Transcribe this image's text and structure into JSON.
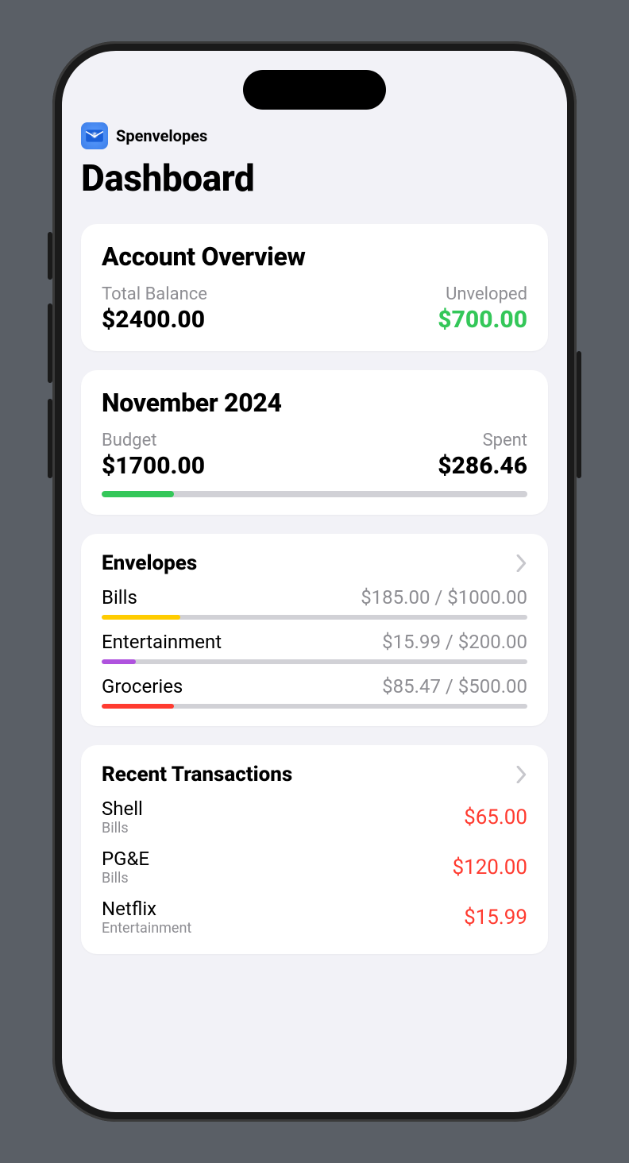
{
  "app": {
    "name": "Spenvelopes"
  },
  "page": {
    "title": "Dashboard"
  },
  "overview": {
    "title": "Account Overview",
    "total_label": "Total Balance",
    "total_value": "$2400.00",
    "unveloped_label": "Unveloped",
    "unveloped_value": "$700.00"
  },
  "month": {
    "title": "November 2024",
    "budget_label": "Budget",
    "budget_value": "$1700.00",
    "spent_label": "Spent",
    "spent_value": "$286.46",
    "progress_pct": 17,
    "progress_color": "#34c759"
  },
  "envelopes": {
    "title": "Envelopes",
    "items": [
      {
        "name": "Bills",
        "amount": "$185.00 / $1000.00",
        "pct": 18.5,
        "color": "#ffcc00"
      },
      {
        "name": "Entertainment",
        "amount": "$15.99 / $200.00",
        "pct": 8,
        "color": "#af52de"
      },
      {
        "name": "Groceries",
        "amount": "$85.47 / $500.00",
        "pct": 17,
        "color": "#ff3b30"
      }
    ]
  },
  "transactions": {
    "title": "Recent Transactions",
    "items": [
      {
        "name": "Shell",
        "category": "Bills",
        "amount": "$65.00"
      },
      {
        "name": "PG&E",
        "category": "Bills",
        "amount": "$120.00"
      },
      {
        "name": "Netflix",
        "category": "Entertainment",
        "amount": "$15.99"
      }
    ]
  }
}
